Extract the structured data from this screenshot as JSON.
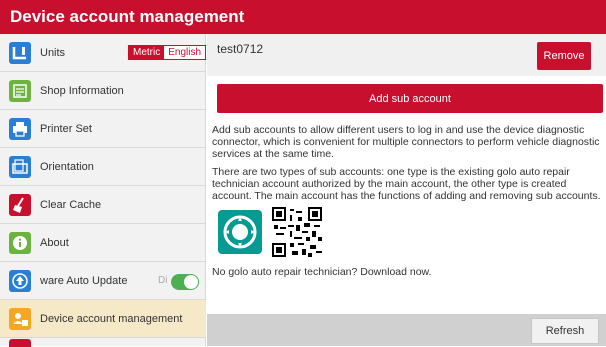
{
  "title": "Device account management",
  "sidebar": {
    "items": [
      {
        "label": "Units",
        "icon": "units-icon",
        "color": "#2a7fd4"
      },
      {
        "label": "Shop Information",
        "icon": "shop-info-icon",
        "color": "#6db33f"
      },
      {
        "label": "Printer Set",
        "icon": "printer-icon",
        "color": "#2a7fd4"
      },
      {
        "label": "Orientation",
        "icon": "orientation-icon",
        "color": "#2a7fd4"
      },
      {
        "label": "Clear Cache",
        "icon": "clear-cache-icon",
        "color": "#c8102e"
      },
      {
        "label": "About",
        "icon": "about-icon",
        "color": "#6db33f"
      },
      {
        "label": "ware Auto Update",
        "icon": "update-icon",
        "color": "#2a7fd4"
      },
      {
        "label": "Device account management",
        "icon": "device-account-icon",
        "color": "#f5a623"
      }
    ],
    "units_metric": "Metric",
    "units_english": "English",
    "auto_update_off_label": "Di",
    "auto_update_enabled": true
  },
  "main": {
    "account_name": "test0712",
    "remove_label": "Remove",
    "add_sub_account_label": "Add sub account",
    "paragraph1": "Add sub accounts to allow different users to log in and use the device diagnostic connector, which is convenient for multiple connectors to perform vehicle diagnostic services at the same time.",
    "paragraph2": "There are two types of sub accounts: one type is the existing golo auto repair technician account authorized by the main account, the other type is created account. The main account has the functions of adding and removing sub accounts.",
    "download_text": "No golo auto repair technician? Download now.",
    "refresh_label": "Refresh"
  },
  "colors": {
    "brand_red": "#c8102e",
    "active_item": "#f5e9c8",
    "toggle_green": "#4caf50",
    "golo_teal": "#079a93"
  }
}
